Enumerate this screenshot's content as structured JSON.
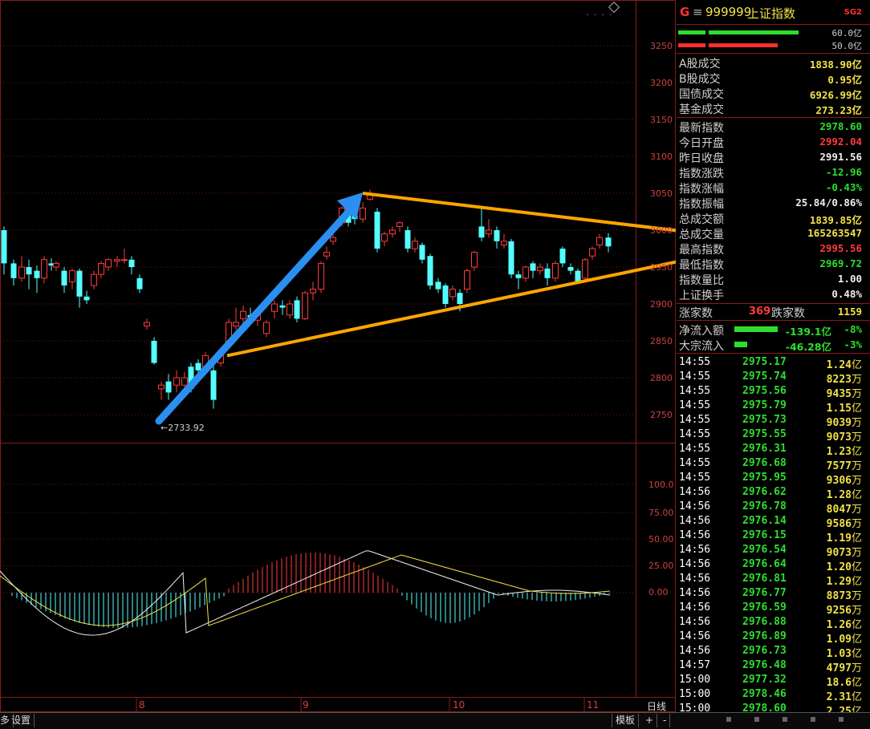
{
  "chart": {
    "y_labels": [
      "3250",
      "3200",
      "3150",
      "3100",
      "3050",
      "3000",
      "2950",
      "2900",
      "2850",
      "2800",
      "2750"
    ],
    "macd_labels": [
      "100.0",
      "75.00",
      "50.00",
      "25.00",
      "0.00"
    ],
    "x_labels": [
      "8",
      "9",
      "10",
      "11"
    ],
    "low_annotation": "←2733.92",
    "top_dots": ". . . .",
    "corner_label": "日线"
  },
  "chart_data": {
    "type": "candlestick",
    "y_range": [
      2700,
      3280
    ],
    "annotations": {
      "low": 2733.92
    },
    "trend_lines": {
      "upper": [
        3050,
        2995
      ],
      "lower": [
        2830,
        2965
      ]
    }
  },
  "header": {
    "marker": "G",
    "eq": "≡",
    "code": "999999",
    "name": "上证指数",
    "badge": "SG2",
    "bar1_value": "60.0亿",
    "bar2_value": "50.0亿"
  },
  "stats": [
    {
      "label": "A股成交",
      "value": "1838.90亿",
      "color": "yellow"
    },
    {
      "label": "B股成交",
      "value": "0.95亿",
      "color": "yellow"
    },
    {
      "label": "国债成交",
      "value": "6926.99亿",
      "color": "yellow"
    },
    {
      "label": "基金成交",
      "value": "273.23亿",
      "color": "yellow"
    }
  ],
  "index_stats": [
    {
      "label": "最新指数",
      "value": "2978.60",
      "color": "green"
    },
    {
      "label": "今日开盘",
      "value": "2992.04",
      "color": "red"
    },
    {
      "label": "昨日收盘",
      "value": "2991.56",
      "color": "white"
    },
    {
      "label": "指数涨跌",
      "value": "-12.96",
      "color": "green"
    },
    {
      "label": "指数涨幅",
      "value": "-0.43%",
      "color": "green"
    },
    {
      "label": "指数振幅",
      "value": "25.84/0.86%",
      "color": "white"
    },
    {
      "label": "总成交额",
      "value": "1839.85亿",
      "color": "yellow"
    },
    {
      "label": "总成交量",
      "value": "165263547",
      "color": "yellow"
    },
    {
      "label": "最高指数",
      "value": "2995.56",
      "color": "red"
    },
    {
      "label": "最低指数",
      "value": "2969.72",
      "color": "green"
    },
    {
      "label": "指数量比",
      "value": "1.00",
      "color": "white"
    },
    {
      "label": "上证换手",
      "value": "0.48%",
      "color": "white"
    }
  ],
  "breadth": {
    "up_label": "涨家数",
    "up_value": "369",
    "down_label": "跌家数",
    "down_value": "1159"
  },
  "flows": [
    {
      "label": "净流入额",
      "value": "-139.1亿",
      "pct": "-8%"
    },
    {
      "label": "大宗流入",
      "value": "-46.28亿",
      "pct": "-3%"
    }
  ],
  "ticks": [
    {
      "time": "14:55",
      "price": "2975.17",
      "vol": "1.24",
      "unit": "亿"
    },
    {
      "time": "14:55",
      "price": "2975.74",
      "vol": "8223",
      "unit": "万"
    },
    {
      "time": "14:55",
      "price": "2975.56",
      "vol": "9435",
      "unit": "万"
    },
    {
      "time": "14:55",
      "price": "2975.79",
      "vol": "1.15",
      "unit": "亿"
    },
    {
      "time": "14:55",
      "price": "2975.73",
      "vol": "9039",
      "unit": "万"
    },
    {
      "time": "14:55",
      "price": "2975.55",
      "vol": "9073",
      "unit": "万"
    },
    {
      "time": "14:55",
      "price": "2976.31",
      "vol": "1.23",
      "unit": "亿"
    },
    {
      "time": "14:55",
      "price": "2976.68",
      "vol": "7577",
      "unit": "万"
    },
    {
      "time": "14:55",
      "price": "2975.95",
      "vol": "9306",
      "unit": "万"
    },
    {
      "time": "14:56",
      "price": "2976.62",
      "vol": "1.28",
      "unit": "亿"
    },
    {
      "time": "14:56",
      "price": "2976.78",
      "vol": "8047",
      "unit": "万"
    },
    {
      "time": "14:56",
      "price": "2976.14",
      "vol": "9586",
      "unit": "万"
    },
    {
      "time": "14:56",
      "price": "2976.15",
      "vol": "1.19",
      "unit": "亿"
    },
    {
      "time": "14:56",
      "price": "2976.54",
      "vol": "9073",
      "unit": "万"
    },
    {
      "time": "14:56",
      "price": "2976.64",
      "vol": "1.20",
      "unit": "亿"
    },
    {
      "time": "14:56",
      "price": "2976.81",
      "vol": "1.29",
      "unit": "亿"
    },
    {
      "time": "14:56",
      "price": "2976.77",
      "vol": "8873",
      "unit": "万"
    },
    {
      "time": "14:56",
      "price": "2976.59",
      "vol": "9256",
      "unit": "万"
    },
    {
      "time": "14:56",
      "price": "2976.88",
      "vol": "1.26",
      "unit": "亿"
    },
    {
      "time": "14:56",
      "price": "2976.89",
      "vol": "1.09",
      "unit": "亿"
    },
    {
      "time": "14:56",
      "price": "2976.73",
      "vol": "1.03",
      "unit": "亿"
    },
    {
      "time": "14:57",
      "price": "2976.48",
      "vol": "4797",
      "unit": "万"
    },
    {
      "time": "15:00",
      "price": "2977.32",
      "vol": "18.6",
      "unit": "亿"
    },
    {
      "time": "15:00",
      "price": "2978.46",
      "vol": "2.31",
      "unit": "亿"
    },
    {
      "time": "15:00",
      "price": "2978.60",
      "vol": "2.25",
      "unit": "亿"
    }
  ],
  "bottom_bar": {
    "left_fragment": "多",
    "settings": "设置",
    "template": "模板",
    "plus": "+",
    "minus": "-"
  }
}
